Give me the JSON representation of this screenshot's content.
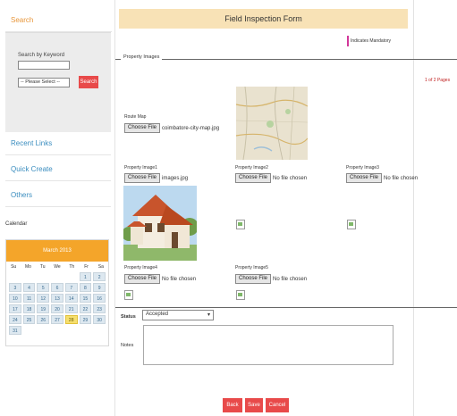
{
  "sidebar": {
    "search_heading": "Search",
    "keyword_label": "Search by Keyword",
    "keyword_value": "",
    "select_value": "-- Please Select --",
    "search_button": "Search",
    "links": [
      "Recent Links",
      "Quick Create",
      "Others"
    ],
    "calendar_label": "Calendar",
    "calendar": {
      "month": "March 2013",
      "weekdays": [
        "Su",
        "Mo",
        "Tu",
        "We",
        "Th",
        "Fr",
        "Sa"
      ],
      "weeks": [
        [
          "",
          "",
          "",
          "",
          "",
          "1",
          "2"
        ],
        [
          "3",
          "4",
          "5",
          "6",
          "7",
          "8",
          "9"
        ],
        [
          "10",
          "11",
          "12",
          "13",
          "14",
          "15",
          "16"
        ],
        [
          "17",
          "18",
          "19",
          "20",
          "21",
          "22",
          "23"
        ],
        [
          "24",
          "25",
          "26",
          "27",
          "28",
          "29",
          "30"
        ],
        [
          "31",
          "",
          "",
          "",
          "",
          "",
          ""
        ]
      ],
      "today": "28"
    }
  },
  "form": {
    "title": "Field Inspection Form",
    "mandatory_note": "Indicates Mandatory",
    "legend": "Property Images",
    "pager": "1 of 2 Pages",
    "choose_label": "Choose File",
    "route_map": {
      "label": "Route Map",
      "file": "coimbatore-city-map.jpg"
    },
    "images": [
      {
        "label": "Property Image1",
        "file": "images.jpg"
      },
      {
        "label": "Property Image2",
        "file": "No file chosen"
      },
      {
        "label": "Property Image3",
        "file": "No file chosen"
      },
      {
        "label": "Property Image4",
        "file": "No file chosen"
      },
      {
        "label": "Property Image5",
        "file": "No file chosen"
      }
    ],
    "status_label": "Status",
    "status_value": "Accepted",
    "notes_label": "Notes",
    "notes_value": "",
    "buttons": {
      "back": "Back",
      "save": "Save",
      "cancel": "Cancel"
    }
  },
  "colors": {
    "accent_orange": "#f4a52a",
    "link_blue": "#3a8dbf",
    "button_red": "#e84a4a",
    "title_bg": "#f8e2b6"
  }
}
